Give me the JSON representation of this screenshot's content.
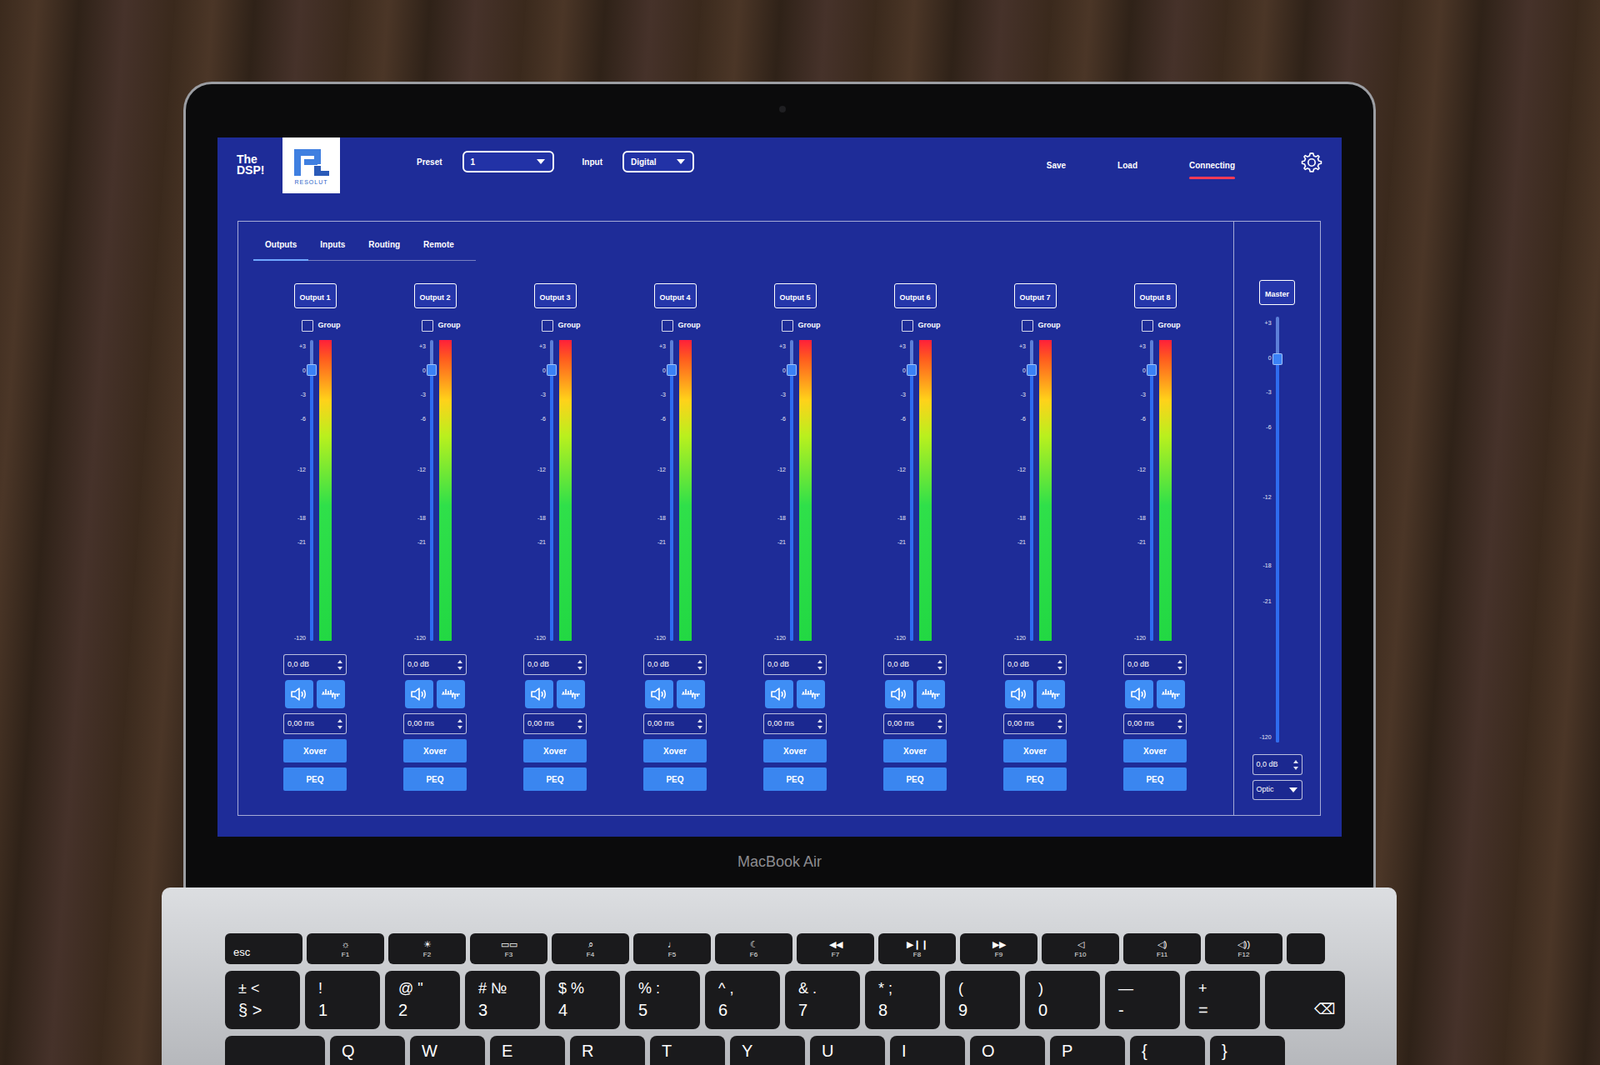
{
  "logo": {
    "lines": [
      "The",
      "DSP!"
    ],
    "brand": "RESOLUT"
  },
  "header": {
    "preset": {
      "label": "Preset",
      "value": "1"
    },
    "input": {
      "label": "Input",
      "value": "Digital"
    },
    "actions": [
      {
        "label": "Save",
        "active": false
      },
      {
        "label": "Load",
        "active": false
      },
      {
        "label": "Connecting",
        "active": true
      }
    ]
  },
  "tabs": [
    {
      "label": "Outputs",
      "selected": true
    },
    {
      "label": "Inputs",
      "selected": false
    },
    {
      "label": "Routing",
      "selected": false
    },
    {
      "label": "Remote",
      "selected": false
    }
  ],
  "scale": [
    {
      "label": "+3",
      "level": 0.98
    },
    {
      "label": "0",
      "level": 0.9
    },
    {
      "label": "-3",
      "level": 0.82
    },
    {
      "label": "-6",
      "level": 0.74
    },
    {
      "label": "-12",
      "level": 0.57
    },
    {
      "label": "-18",
      "level": 0.41
    },
    {
      "label": "-21",
      "level": 0.33
    },
    {
      "label": "-120",
      "level": 0.01
    }
  ],
  "channels": [
    {
      "name": "Output 1",
      "group_label": "Group",
      "group": false,
      "fader_level": 0.9,
      "meter_level": 1,
      "gain": "0,0 dB",
      "muted": false,
      "delay": "0,00 ms",
      "xover": "Xover",
      "peq": "PEQ"
    },
    {
      "name": "Output 2",
      "group_label": "Group",
      "group": false,
      "fader_level": 0.9,
      "meter_level": 1,
      "gain": "0,0 dB",
      "muted": false,
      "delay": "0,00 ms",
      "xover": "Xover",
      "peq": "PEQ"
    },
    {
      "name": "Output 3",
      "group_label": "Group",
      "group": false,
      "fader_level": 0.9,
      "meter_level": 1,
      "gain": "0,0 dB",
      "muted": false,
      "delay": "0,00 ms",
      "xover": "Xover",
      "peq": "PEQ"
    },
    {
      "name": "Output 4",
      "group_label": "Group",
      "group": false,
      "fader_level": 0.9,
      "meter_level": 1,
      "gain": "0,0 dB",
      "muted": false,
      "delay": "0,00 ms",
      "xover": "Xover",
      "peq": "PEQ"
    },
    {
      "name": "Output 5",
      "group_label": "Group",
      "group": false,
      "fader_level": 0.9,
      "meter_level": 1,
      "gain": "0,0 dB",
      "muted": false,
      "delay": "0,00 ms",
      "xover": "Xover",
      "peq": "PEQ"
    },
    {
      "name": "Output 6",
      "group_label": "Group",
      "group": false,
      "fader_level": 0.9,
      "meter_level": 1,
      "gain": "0,0 dB",
      "muted": false,
      "delay": "0,00 ms",
      "xover": "Xover",
      "peq": "PEQ"
    },
    {
      "name": "Output 7",
      "group_label": "Group",
      "group": false,
      "fader_level": 0.9,
      "meter_level": 1,
      "gain": "0,0 dB",
      "muted": false,
      "delay": "0,00 ms",
      "xover": "Xover",
      "peq": "PEQ"
    },
    {
      "name": "Output 8",
      "group_label": "Group",
      "group": false,
      "fader_level": 0.9,
      "meter_level": 1,
      "gain": "0,0 dB",
      "muted": false,
      "delay": "0,00 ms",
      "xover": "Xover",
      "peq": "PEQ"
    }
  ],
  "master": {
    "name": "Master",
    "scale": [
      {
        "label": "+3",
        "level": 0.986
      },
      {
        "label": "0",
        "level": 0.904
      },
      {
        "label": "-3",
        "level": 0.823
      },
      {
        "label": "-6",
        "level": 0.742
      },
      {
        "label": "-12",
        "level": 0.577
      },
      {
        "label": "-18",
        "level": 0.416
      },
      {
        "label": "-21",
        "level": 0.333
      },
      {
        "label": "-120",
        "level": 0.014
      }
    ],
    "fader_level": 0.9,
    "gain": "0,0 dB",
    "source": "Optic"
  },
  "laptop": {
    "label": "MacBook Air"
  },
  "keyboard": {
    "esc": "esc",
    "fn_row": [
      {
        "label": "F1",
        "icon": "☼"
      },
      {
        "label": "F2",
        "icon": "☀"
      },
      {
        "label": "F3",
        "icon": "▭▭"
      },
      {
        "label": "F4",
        "icon": "⌕"
      },
      {
        "label": "F5",
        "icon": "♩"
      },
      {
        "label": "F6",
        "icon": "☾"
      },
      {
        "label": "F7",
        "icon": "◀◀"
      },
      {
        "label": "F8",
        "icon": "▶❙❙"
      },
      {
        "label": "F9",
        "icon": "▶▶"
      },
      {
        "label": "F10",
        "icon": "◁"
      },
      {
        "label": "F11",
        "icon": "◁)"
      },
      {
        "label": "F12",
        "icon": "◁))"
      }
    ],
    "number_row": [
      {
        "top": "± <",
        "bottom": "§ >"
      },
      {
        "top": "!",
        "bottom": "1"
      },
      {
        "top": "@ \"",
        "bottom": "2"
      },
      {
        "top": "# №",
        "bottom": "3"
      },
      {
        "top": "$ %",
        "bottom": "4"
      },
      {
        "top": "% :",
        "bottom": "5"
      },
      {
        "top": "^ ,",
        "bottom": "6"
      },
      {
        "top": "& .",
        "bottom": "7"
      },
      {
        "top": "* ;",
        "bottom": "8"
      },
      {
        "top": "(",
        "bottom": "9"
      },
      {
        "top": ")",
        "bottom": "0"
      },
      {
        "top": "—",
        "bottom": "-"
      },
      {
        "top": "+",
        "bottom": "="
      }
    ],
    "delete": "⌫",
    "letter_row": [
      "Q",
      "W",
      "E",
      "R",
      "T",
      "Y",
      "U",
      "I",
      "O",
      "P",
      "{",
      "}"
    ]
  }
}
